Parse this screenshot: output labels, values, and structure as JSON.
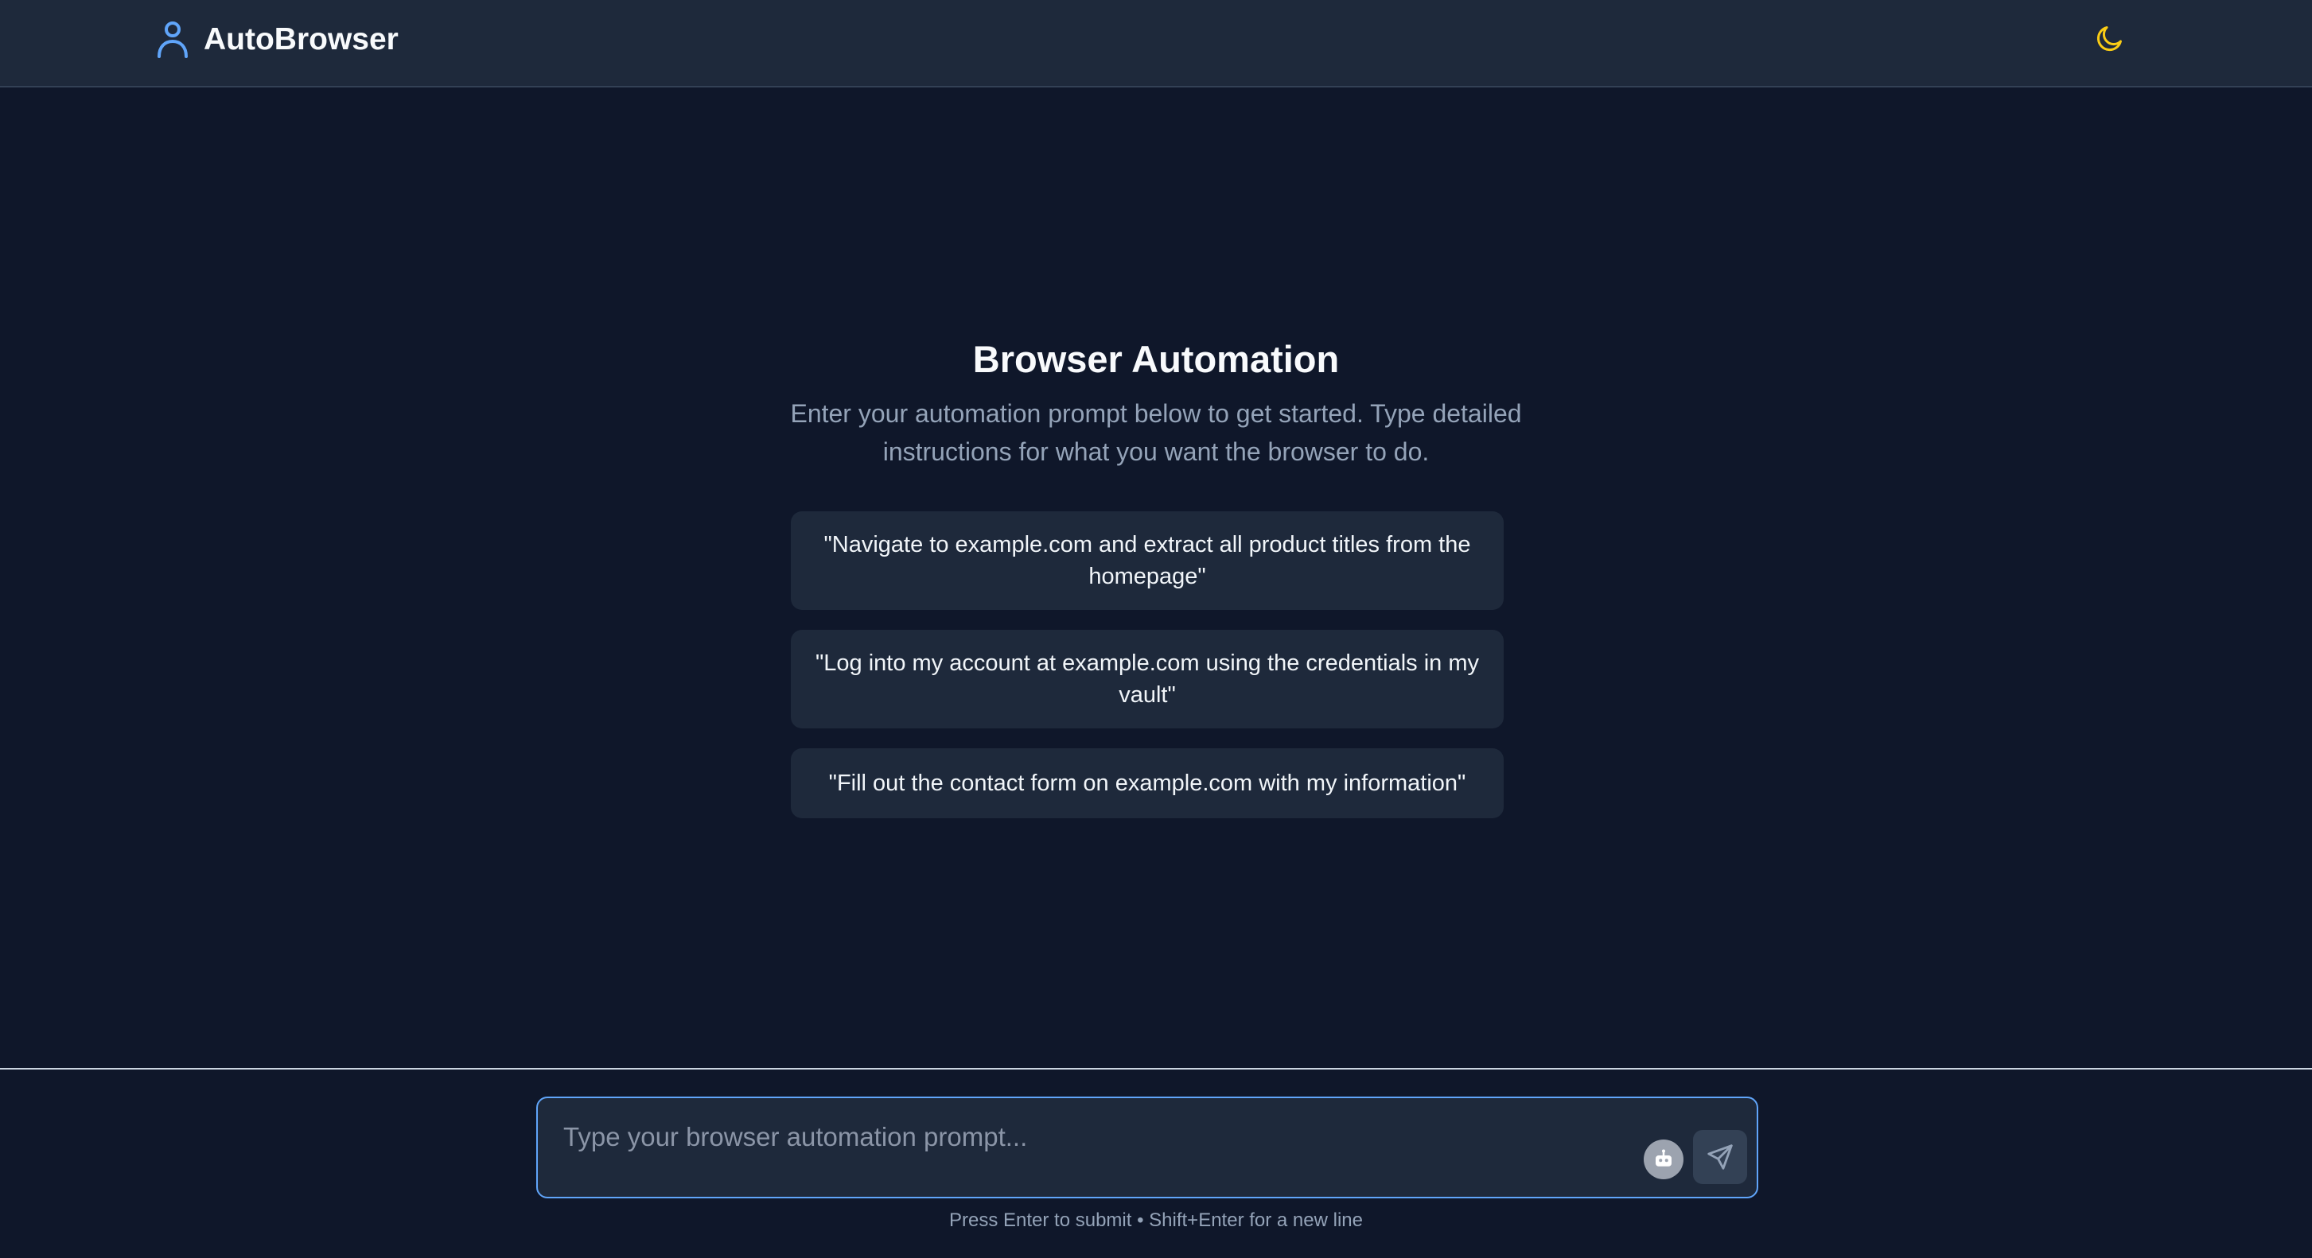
{
  "header": {
    "brand_icon": "user-icon",
    "brand_name": "AutoBrowser",
    "theme_icon": "moon-icon"
  },
  "intro": {
    "title": "Browser Automation",
    "subtitle": "Enter your automation prompt below to get started. Type detailed instructions for what you want the browser to do."
  },
  "examples": [
    {
      "text": "\"Navigate to example.com and extract all product titles from the homepage\""
    },
    {
      "text": "\"Log into my account at example.com using the credentials in my vault\""
    },
    {
      "text": "\"Fill out the contact form on example.com with my information\""
    }
  ],
  "composer": {
    "placeholder": "Type your browser automation prompt...",
    "value": "",
    "agent_icon": "robot-icon",
    "send_icon": "send-icon",
    "hint": "Press Enter to submit • Shift+Enter for a new line"
  },
  "colors": {
    "background": "#0f172a",
    "surface": "#1e293b",
    "accent": "#60a5fa",
    "moon": "#facc15",
    "muted_text": "#94a3b8"
  }
}
